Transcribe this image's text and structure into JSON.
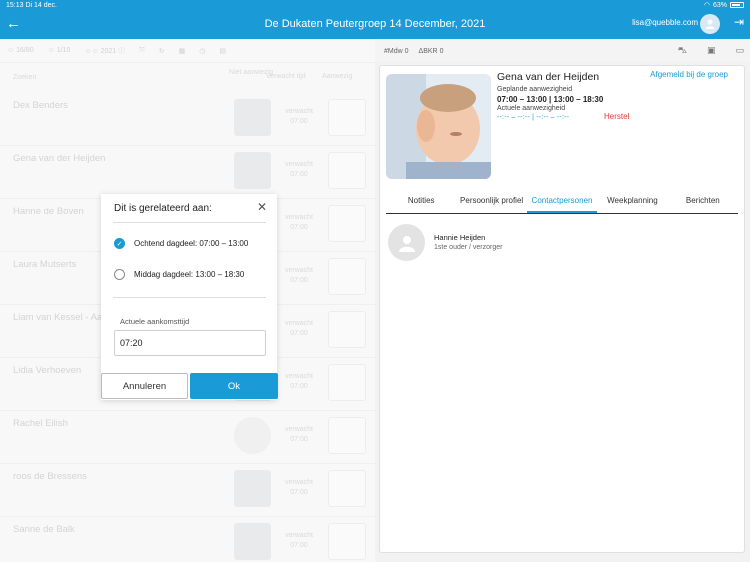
{
  "status_bar": {
    "time": "15:13",
    "date": "Di 14 dec.",
    "battery": "63%",
    "wifi_icon": "wifi-icon"
  },
  "header": {
    "title": "De Dukaten Peutergroep 14 December, 2021",
    "email": "lisa@quebble.com"
  },
  "left_toolbar": {
    "count_a": "16/80",
    "count_b": "1/10",
    "count_c": "2021",
    "icons": [
      "person-icon",
      "expand-icon",
      "refresh-icon",
      "grid-icon",
      "clock-icon",
      "calendar-icon"
    ]
  },
  "columns": {
    "name": "Zoeken",
    "photo": "Niet aanwezig",
    "expected": "Verwacht tijd",
    "present": "Aanwezig"
  },
  "children": [
    {
      "name": "Dex Benders",
      "expected_label": "verwacht",
      "expected_time": "07:00",
      "photo": "photo"
    },
    {
      "name": "Gena van der Heijden",
      "expected_label": "verwacht",
      "expected_time": "07:00",
      "photo": "photo"
    },
    {
      "name": "Hanne de Boven",
      "expected_label": "verwacht",
      "expected_time": "07:00",
      "photo": "photo"
    },
    {
      "name": "Laura Mutserts",
      "expected_label": "verwacht",
      "expected_time": "07:00",
      "photo": "photo"
    },
    {
      "name": "Liam van Kessel - Aa",
      "expected_label": "verwacht",
      "expected_time": "07:00",
      "photo": "photo"
    },
    {
      "name": "Lidia Verhoeven",
      "expected_label": "verwacht",
      "expected_time": "07:00",
      "photo": "photo"
    },
    {
      "name": "Rachel Eilish",
      "expected_label": "verwacht",
      "expected_time": "07:00",
      "photo": "placeholder"
    },
    {
      "name": "roos de Bressens",
      "expected_label": "verwacht",
      "expected_time": "07:00",
      "photo": "photo"
    },
    {
      "name": "Sanne de Balk",
      "expected_label": "verwacht",
      "expected_time": "07:00",
      "photo": "photo"
    }
  ],
  "right_toolbar": {
    "mdw": "#Mdw",
    "mdw_value": "0",
    "bkr": "ΔBKR",
    "bkr_value": "0"
  },
  "profile": {
    "name": "Gena van der Heijden",
    "afgemeld": "Afgemeld bij de groep",
    "planned_label": "Geplande aanwezigheid",
    "planned_value": "07:00 – 13:00 | 13:00 – 18:30",
    "actual_label": "Actuele aanwezigheid",
    "actual_value": "--:-- – --:-- | --:-- – --:--",
    "herstel": "Herstel"
  },
  "tabs": [
    "Notities",
    "Persoonlijk profiel",
    "Contactpersonen",
    "Weekplanning",
    "Berichten"
  ],
  "active_tab": "Contactpersonen",
  "contact": {
    "name": "Hannie Heijden",
    "role": "1ste ouder / verzorger"
  },
  "dialog": {
    "title": "Dit is gerelateerd aan:",
    "option1": "Ochtend dagdeel: 07:00 – 13:00",
    "option2": "Middag dagdeel: 13:00 – 18:30",
    "selected": 1,
    "field_label": "Actuele aankomsttijd",
    "field_value": "07:20",
    "cancel": "Annuleren",
    "ok": "Ok"
  },
  "colors": {
    "accent": "#1a9ad6",
    "danger": "#e53935"
  }
}
